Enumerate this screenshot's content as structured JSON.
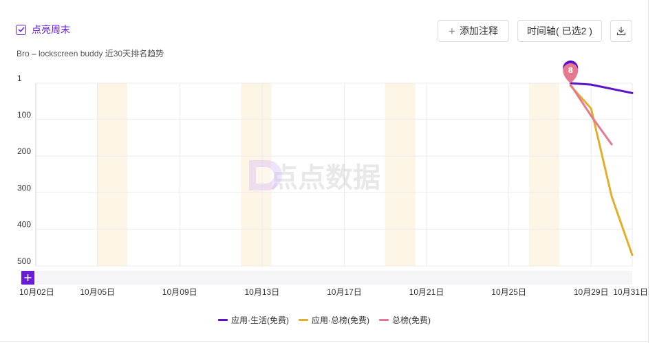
{
  "header": {
    "weekend_label": "点亮周末",
    "subtitle": "Bro – lockscreen buddy 近30天排名趋势",
    "annot_label": "添加注释",
    "time_label": "时间轴( 已选2 )"
  },
  "watermark": "点点数据",
  "colors": {
    "accent": "#6a1bd9",
    "weekend": "#fdf5e6",
    "grid": "#ebebeb"
  },
  "chart_data": {
    "type": "line",
    "y_inverted": true,
    "ylim": [
      1,
      500
    ],
    "yticks": [
      "1",
      "100",
      "200",
      "300",
      "400",
      "500"
    ],
    "x_start": "10月02日",
    "x_end": "10月31日",
    "xticks": [
      "10月02日",
      "10月05日",
      "10月09日",
      "10月13日",
      "10月17日",
      "10月21日",
      "10月25日",
      "10月29日",
      "10月31日"
    ],
    "weekends": [
      5,
      12,
      19,
      26
    ],
    "series": [
      {
        "name": "应用·生活(免费)",
        "color": "#5b12c9",
        "points": [
          [
            28,
            1
          ],
          [
            29,
            5
          ],
          [
            31,
            28
          ]
        ]
      },
      {
        "name": "应用·总榜(免费)",
        "color": "#e2ae2c",
        "points": [
          [
            28,
            8
          ],
          [
            29,
            70
          ],
          [
            30,
            310
          ],
          [
            31,
            470
          ]
        ]
      },
      {
        "name": "总榜(免费)",
        "color": "#e4798f",
        "points": [
          [
            28,
            5
          ],
          [
            29,
            90
          ],
          [
            30,
            168
          ]
        ]
      }
    ],
    "marker": {
      "day": 28,
      "label": "8"
    }
  }
}
